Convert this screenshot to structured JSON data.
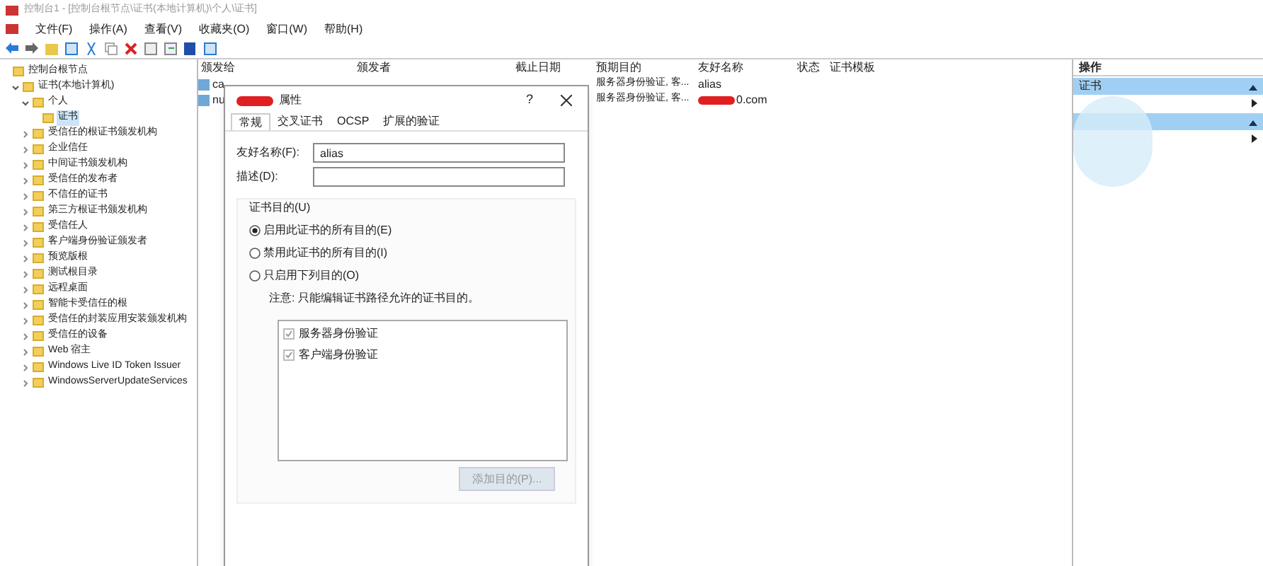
{
  "window": {
    "title": "控制台1 - [控制台根节点\\证书(本地计算机)\\个人\\证书]"
  },
  "menu": [
    "文件(F)",
    "操作(A)",
    "查看(V)",
    "收藏夹(O)",
    "窗口(W)",
    "帮助(H)"
  ],
  "tree": [
    {
      "label": "控制台根节点",
      "expanded": true,
      "children": [
        {
          "label": "证书(本地计算机)",
          "expanded": true,
          "children": [
            {
              "label": "个人",
              "expanded": true,
              "children": [
                {
                  "label": "证书",
                  "selected": true
                }
              ]
            },
            {
              "label": "受信任的根证书颁发机构",
              "expanded": false
            },
            {
              "label": "企业信任",
              "expanded": false
            },
            {
              "label": "中间证书颁发机构",
              "expanded": false
            },
            {
              "label": "受信任的发布者",
              "expanded": false
            },
            {
              "label": "不信任的证书",
              "expanded": false
            },
            {
              "label": "第三方根证书颁发机构",
              "expanded": false
            },
            {
              "label": "受信任人",
              "expanded": false
            },
            {
              "label": "客户端身份验证颁发者",
              "expanded": false
            },
            {
              "label": "预览版根",
              "expanded": false
            },
            {
              "label": "测试根目录",
              "expanded": false
            },
            {
              "label": "远程桌面",
              "expanded": false
            },
            {
              "label": "智能卡受信任的根",
              "expanded": false
            },
            {
              "label": "受信任的封装应用安装颁发机构",
              "expanded": false
            },
            {
              "label": "受信任的设备",
              "expanded": false
            },
            {
              "label": "Web 宿主",
              "expanded": false
            },
            {
              "label": "Windows Live ID Token Issuer",
              "expanded": false
            },
            {
              "label": "WindowsServerUpdateServices",
              "expanded": false
            }
          ]
        }
      ]
    }
  ],
  "table": {
    "columns": [
      "颁发给",
      "颁发者",
      "截止日期",
      "预期目的",
      "友好名称",
      "状态",
      "证书模板"
    ],
    "rows": [
      {
        "issued_to": "ca",
        "purposes": "服务器身份验证, 客...",
        "friendly_name": "alias",
        "redacted": false
      },
      {
        "issued_to": "nu",
        "purposes": "服务器身份验证, 客...",
        "friendly_name": "0.com",
        "redacted": true
      }
    ]
  },
  "actions": {
    "title": "操作",
    "sections": [
      {
        "label": "证书",
        "expanded": true
      },
      {
        "expanded": true
      }
    ]
  },
  "dialog": {
    "title": "属性",
    "help": "?",
    "tabs": [
      {
        "label": "常规",
        "selected": true
      },
      {
        "label": "交叉证书",
        "selected": false
      },
      {
        "label": "OCSP",
        "selected": false
      },
      {
        "label": "扩展的验证",
        "selected": false
      }
    ],
    "fields": [
      {
        "label": "友好名称(F):",
        "value": "alias"
      },
      {
        "label": "描述(D):"
      }
    ],
    "group": "证书目的(U)",
    "radios": [
      {
        "label": "启用此证书的所有目的(E)",
        "selected": true
      },
      {
        "label": "禁用此证书的所有目的(I)",
        "selected": false
      },
      {
        "label": "只启用下列目的(O)",
        "selected": false
      }
    ],
    "note": "注意: 只能编辑证书路径允许的证书目的。",
    "purposes": [
      {
        "label": "服务器身份验证",
        "checked": true
      },
      {
        "label": "客户端身份验证",
        "checked": true
      }
    ],
    "add_button": {
      "label": "添加目的(P)...",
      "disabled": true
    }
  }
}
